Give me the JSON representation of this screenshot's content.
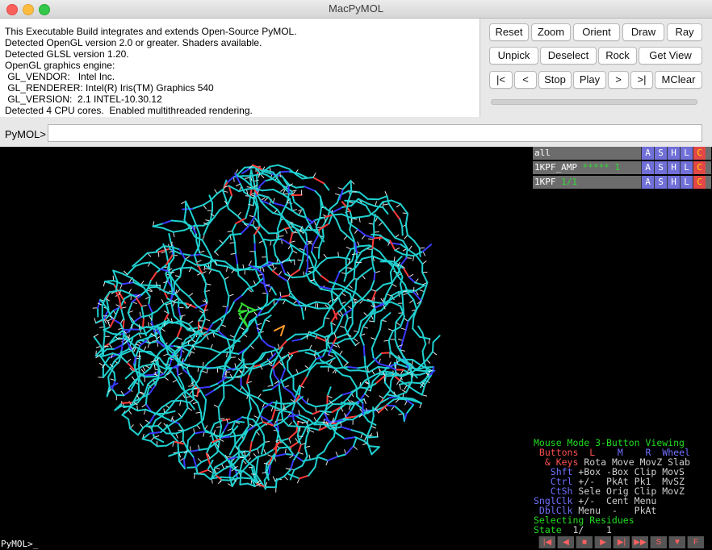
{
  "window": {
    "title": "MacPyMOL"
  },
  "output_lines": [
    "This Executable Build integrates and extends Open-Source PyMOL.",
    "Detected OpenGL version 2.0 or greater. Shaders available.",
    "Detected GLSL version 1.20.",
    "OpenGL graphics engine:",
    " GL_VENDOR:   Intel Inc.",
    " GL_RENDERER: Intel(R) Iris(TM) Graphics 540",
    " GL_VERSION:  2.1 INTEL-10.30.12",
    "Detected 4 CPU cores.  Enabled multithreaded rendering."
  ],
  "buttons": {
    "reset": "Reset",
    "zoom": "Zoom",
    "orient": "Orient",
    "draw": "Draw",
    "ray": "Ray",
    "unpick": "Unpick",
    "deselect": "Deselect",
    "rock": "Rock",
    "get_view": "Get View",
    "first": "|<",
    "prev": "<",
    "stop": "Stop",
    "play": "Play",
    "next": ">",
    "last": ">|",
    "mclear": "MClear"
  },
  "command": {
    "prompt": "PyMOL>",
    "value": ""
  },
  "objects": [
    {
      "name": "all",
      "state": ""
    },
    {
      "name": "1KPF_AMP",
      "state": "***** 1"
    },
    {
      "name": "1KPF",
      "state": "1/1"
    }
  ],
  "object_buttons": {
    "a": "A",
    "s": "S",
    "h": "H",
    "l": "L",
    "c": "C"
  },
  "mouse_help": {
    "mode": "Mouse Mode 3-Button Viewing",
    "header": {
      "buttons": " Buttons",
      "l": "L",
      "m": "M",
      "r": "R",
      "wheel": "Wheel"
    },
    "keys_label": "  & Keys",
    "keys_vals": "Rota Move MovZ Slab",
    "rows": [
      {
        "label": "   Shft",
        "vals": "+Box -Box Clip MovS"
      },
      {
        "label": "   Ctrl",
        "vals": "+/-  PkAt Pk1  MvSZ"
      },
      {
        "label": "   CtSh",
        "vals": "Sele Orig Clip MovZ"
      },
      {
        "label": "SnglClk",
        "vals": "+/-  Cent Menu"
      },
      {
        "label": " DblClk",
        "vals": "Menu  -   PkAt"
      }
    ],
    "selecting": "Selecting Residues",
    "state_label": "State",
    "state_value": "  1/    1"
  },
  "player_buttons": [
    "|◀",
    "◀",
    "■",
    "▶",
    "▶|",
    "▶▶",
    "S",
    "▼",
    "F"
  ],
  "bottom_prompt": "PyMOL>_",
  "colors": {
    "carbon": "#20d0d0",
    "hydrogen": "#e6e6e6",
    "nitrogen": "#3a3aff",
    "oxygen": "#ff3a3a",
    "ligand": "#33dd33"
  }
}
